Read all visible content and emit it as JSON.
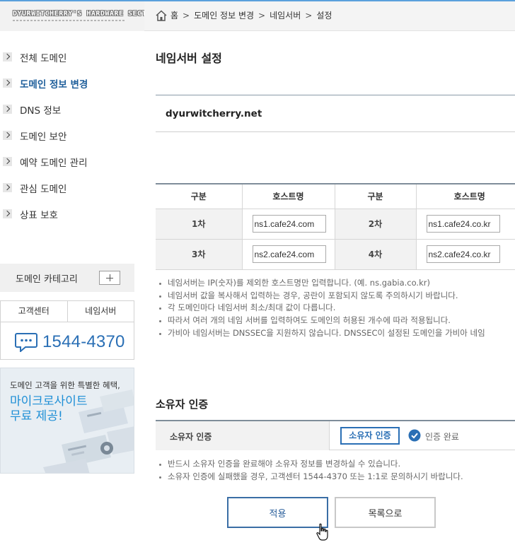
{
  "header": {
    "logo_text": "DYURWITCHERRY'S HARDWARE SECTOR",
    "breadcrumb": [
      "홈",
      "도메인 정보 변경",
      "네임서버",
      "설정"
    ],
    "breadcrumb_sep": ">"
  },
  "sidebar": {
    "items": [
      {
        "label": "전체 도메인",
        "active": false
      },
      {
        "label": "도메인 정보 변경",
        "active": true
      },
      {
        "label": "DNS 정보",
        "active": false
      },
      {
        "label": "도메인 보안",
        "active": false
      },
      {
        "label": "예약 도메인 관리",
        "active": false
      },
      {
        "label": "관심 도메인",
        "active": false
      },
      {
        "label": "상표 보호",
        "active": false
      }
    ],
    "category_label": "도메인 카테고리",
    "support_tabs": [
      "고객센터",
      "네임서버"
    ],
    "phone": "1544-4370",
    "promo_small": "도메인 고객을 위한 특별한 혜택,",
    "promo_big_line1": "마이크로사이트",
    "promo_big_line2": "무료 제공!"
  },
  "main": {
    "title": "네임서버 설정",
    "domain": "dyurwitcherry.net",
    "table": {
      "headers": [
        "구분",
        "호스트명",
        "구분",
        "호스트명"
      ],
      "rows": [
        {
          "label_a": "1차",
          "host_a": "ns1.cafe24.com",
          "label_b": "2차",
          "host_b": "ns1.cafe24.co.kr"
        },
        {
          "label_a": "3차",
          "host_a": "ns2.cafe24.com",
          "label_b": "4차",
          "host_b": "ns2.cafe24.co.kr"
        }
      ]
    },
    "notes": [
      "네임서버는 IP(숫자)를 제외한 호스트명만 입력합니다. (예. ns.gabia.co.kr)",
      "네임서버 값을 복사해서 입력하는 경우, 공란이 포함되지 않도록 주의하시기 바랍니다.",
      "각 도메인마다 네임서버 최소/최대 값이 다릅니다.",
      "따라서 여러 개의 네임 서버를 입력하여도 도메인의 허용된 개수에 따라 적용됩니다.",
      "가비아 네임서버는 DNSSEC을 지원하지 않습니다. DNSSEC이 설정된 도메인을 가비아 네임"
    ],
    "owner": {
      "title": "소유자 인증",
      "label": "소유자 인증",
      "button": "소유자 인증",
      "status": "인증 완료",
      "notes": [
        "반드시 소유자 인증을 완료해야 소유자 정보를 변경하실 수 있습니다.",
        "소유자 인증에 실패했을 경우, 고객센터 1544-4370 또는 1:1로 문의하시기 바랍니다."
      ]
    },
    "buttons": {
      "apply": "적용",
      "list": "목록으로"
    }
  },
  "colors": {
    "accent": "#2a6fb5",
    "active_nav": "#1f5f9b",
    "promo_text": "#1e8fd6"
  }
}
